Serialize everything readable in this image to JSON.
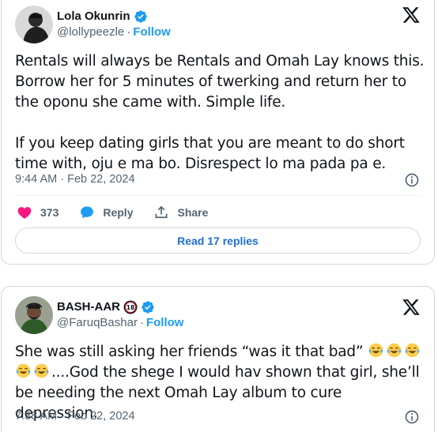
{
  "tweets": [
    {
      "author": {
        "name": "Lola Okunrin",
        "handle": "@lollypeezle",
        "follow_label": "Follow",
        "verified": true
      },
      "text": "Rentals will always be Rentals and Omah Lay knows this. Borrow her for 5 minutes of twerking and return her to the oponu she came with. Simple life.\n\nIf you keep dating girls that you are meant to do short time with, oju e ma bo. Disrespect lo ma pada pa e.",
      "timestamp": "9:44 AM · Feb 22, 2024",
      "likes": "373",
      "reply_label": "Reply",
      "share_label": "Share",
      "read_replies_label": "Read 17 replies"
    },
    {
      "author": {
        "name": "BASH-AAR",
        "handle": "@FaruqBashar",
        "follow_label": "Follow",
        "verified": true,
        "age_badge": "18"
      },
      "text_part1": "She was still asking her friends “was it that bad” ",
      "text_part2": "....God the shege I would hav shown that girl, she’ll be needing the next Omah Lay album to cure depression.",
      "emoji_name": "face-with-tears-of-joy",
      "timestamp": "7:38 AM · Feb 22, 2024"
    }
  ],
  "colors": {
    "like": "#f91880",
    "link": "#1d9bf0",
    "verified": "#1d9bf0",
    "muted": "#536471"
  }
}
